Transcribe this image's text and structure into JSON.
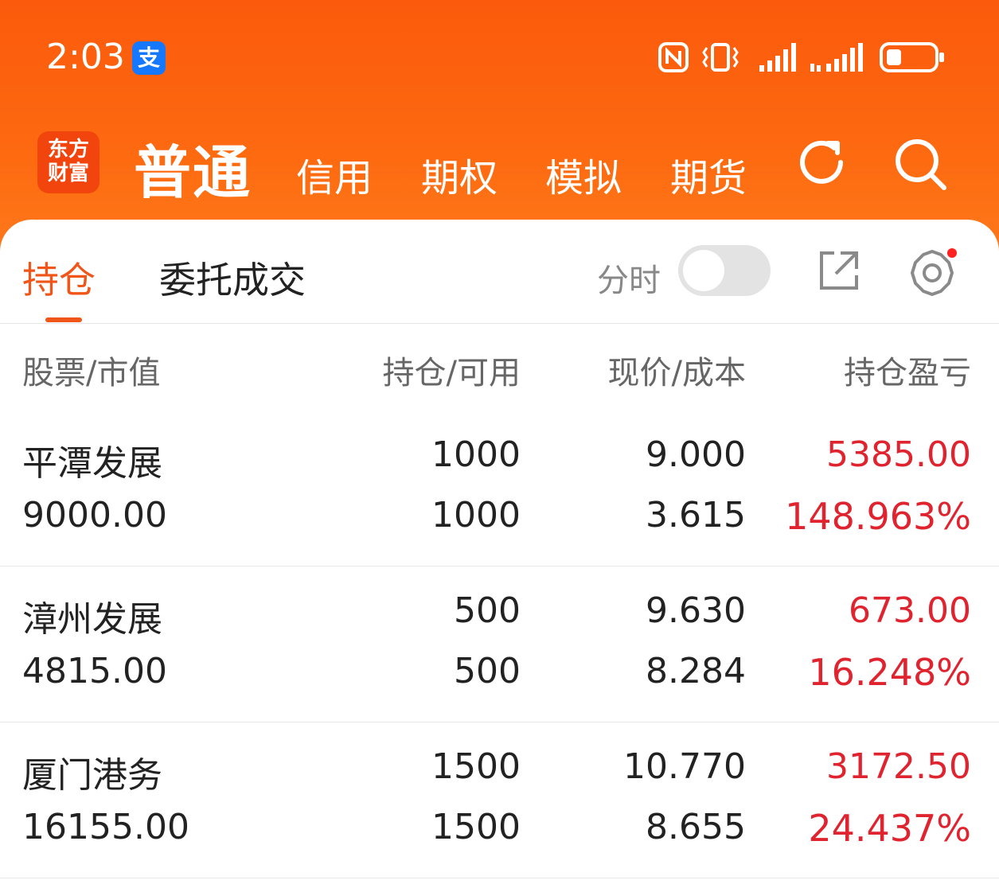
{
  "status_bar": {
    "time": "2:03",
    "alipay_badge": "支"
  },
  "nav": {
    "logo_text": "东方\n财富",
    "logo_line1": "东方",
    "logo_line2": "财富",
    "items": [
      {
        "label": "普通",
        "active": true
      },
      {
        "label": "信用"
      },
      {
        "label": "期权"
      },
      {
        "label": "模拟"
      },
      {
        "label": "期货"
      }
    ],
    "icons": [
      "refresh-icon",
      "search-icon"
    ]
  },
  "tabs": {
    "active": "持仓",
    "other": "委托成交",
    "toggle_label": "分时",
    "toggle_on": false,
    "icons": [
      "share-icon",
      "settings-icon"
    ]
  },
  "table": {
    "headers": [
      "股票/市值",
      "持仓/可用",
      "现价/成本",
      "持仓盈亏"
    ],
    "rows": [
      {
        "name": "平潭发展",
        "market_value": "9000.00",
        "position": "1000",
        "available": "1000",
        "price": "9.000",
        "cost": "3.615",
        "pl": "5385.00",
        "pl_pct": "148.963%"
      },
      {
        "name": "漳州发展",
        "market_value": "4815.00",
        "position": "500",
        "available": "500",
        "price": "9.630",
        "cost": "8.284",
        "pl": "673.00",
        "pl_pct": "16.248%"
      },
      {
        "name": "厦门港务",
        "market_value": "16155.00",
        "position": "1500",
        "available": "1500",
        "price": "10.770",
        "cost": "8.655",
        "pl": "3172.50",
        "pl_pct": "24.437%"
      }
    ]
  },
  "colors": {
    "header_orange": "#fb5a0c",
    "accent": "#f0561a",
    "profit_red": "#e0242f",
    "alipay_blue": "#1677ff"
  }
}
